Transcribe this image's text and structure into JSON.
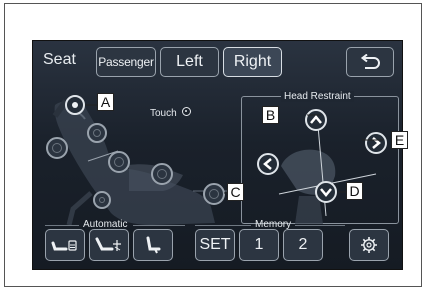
{
  "tabs": {
    "seat_label": "Seat",
    "passenger": "Passenger",
    "left": "Left",
    "right": "Right",
    "active": "Right"
  },
  "touch_label": "Touch",
  "head_restraint": {
    "title": "Head Restraint"
  },
  "callouts": {
    "a": "A",
    "b": "B",
    "c": "C",
    "d": "D",
    "e": "E"
  },
  "sections": {
    "automatic": "Automatic",
    "memory": "Memory"
  },
  "buttons": {
    "set": "SET",
    "mem1": "1",
    "mem2": "2"
  },
  "icons": {
    "back": "return-arrow-icon",
    "settings": "gear-icon",
    "auto1": "seat-recline-icon",
    "auto2": "seat-reclined-icon",
    "auto3": "seat-upright-icon",
    "head_up": "chevron-up-icon",
    "head_down": "chevron-down-icon",
    "head_left": "chevron-left-icon",
    "head_right": "chevron-right-icon"
  },
  "colors": {
    "screen_bg": "#1c2430",
    "button_border": "#9aa3ad",
    "text": "#eef1f4"
  }
}
